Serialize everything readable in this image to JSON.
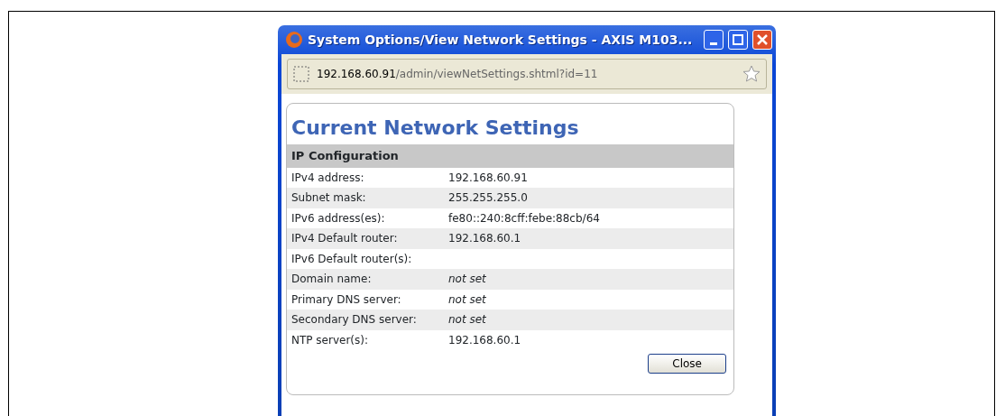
{
  "window": {
    "title": "System Options/View Network Settings - AXIS M103..."
  },
  "address_bar": {
    "host": "192.168.60.91",
    "path": "/admin/viewNetSettings.shtml?id=11"
  },
  "heading": "Current Network Settings",
  "section": "IP Configuration",
  "rows": [
    {
      "label": "IPv4 address:",
      "value": "192.168.60.91",
      "kind": "value"
    },
    {
      "label": "Subnet mask:",
      "value": "255.255.255.0",
      "kind": "value"
    },
    {
      "label": "IPv6 address(es):",
      "value": "fe80::240:8cff:febe:88cb/64",
      "kind": "value"
    },
    {
      "label": "IPv4 Default router:",
      "value": "192.168.60.1",
      "kind": "value"
    },
    {
      "label": "IPv6 Default router(s):",
      "kind": "empty"
    },
    {
      "label": "Domain name:",
      "value": "not set",
      "kind": "unset"
    },
    {
      "label": "Primary DNS server:",
      "value": "not set",
      "kind": "unset"
    },
    {
      "label": "Secondary DNS server:",
      "value": "not set",
      "kind": "unset"
    },
    {
      "label": "NTP server(s):",
      "value": "192.168.60.1",
      "kind": "value"
    }
  ],
  "buttons": [
    "Close"
  ]
}
